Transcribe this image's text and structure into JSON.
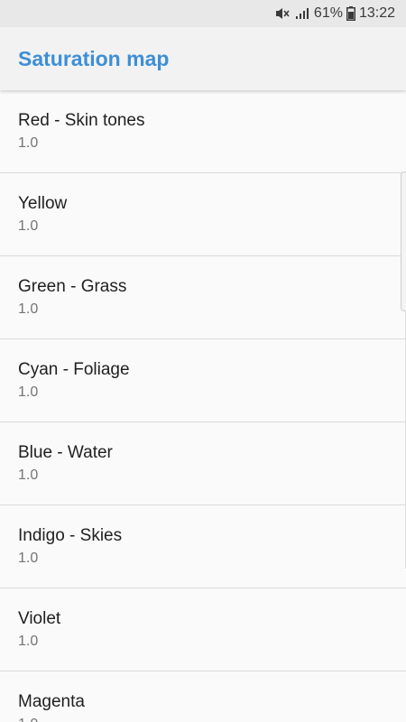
{
  "status_bar": {
    "battery_percent": "61%",
    "time": "13:22",
    "icons": [
      "mute-icon",
      "signal-icon",
      "battery-icon"
    ]
  },
  "app_bar": {
    "title": "Saturation map",
    "title_color": "#3d8fd6"
  },
  "items": [
    {
      "title": "Red - Skin tones",
      "value": "1.0"
    },
    {
      "title": "Yellow",
      "value": "1.0"
    },
    {
      "title": "Green - Grass",
      "value": "1.0"
    },
    {
      "title": "Cyan - Foliage",
      "value": "1.0"
    },
    {
      "title": "Blue - Water",
      "value": "1.0"
    },
    {
      "title": "Indigo - Skies",
      "value": "1.0"
    },
    {
      "title": "Violet",
      "value": "1.0"
    },
    {
      "title": "Magenta",
      "value": "1.0"
    }
  ]
}
